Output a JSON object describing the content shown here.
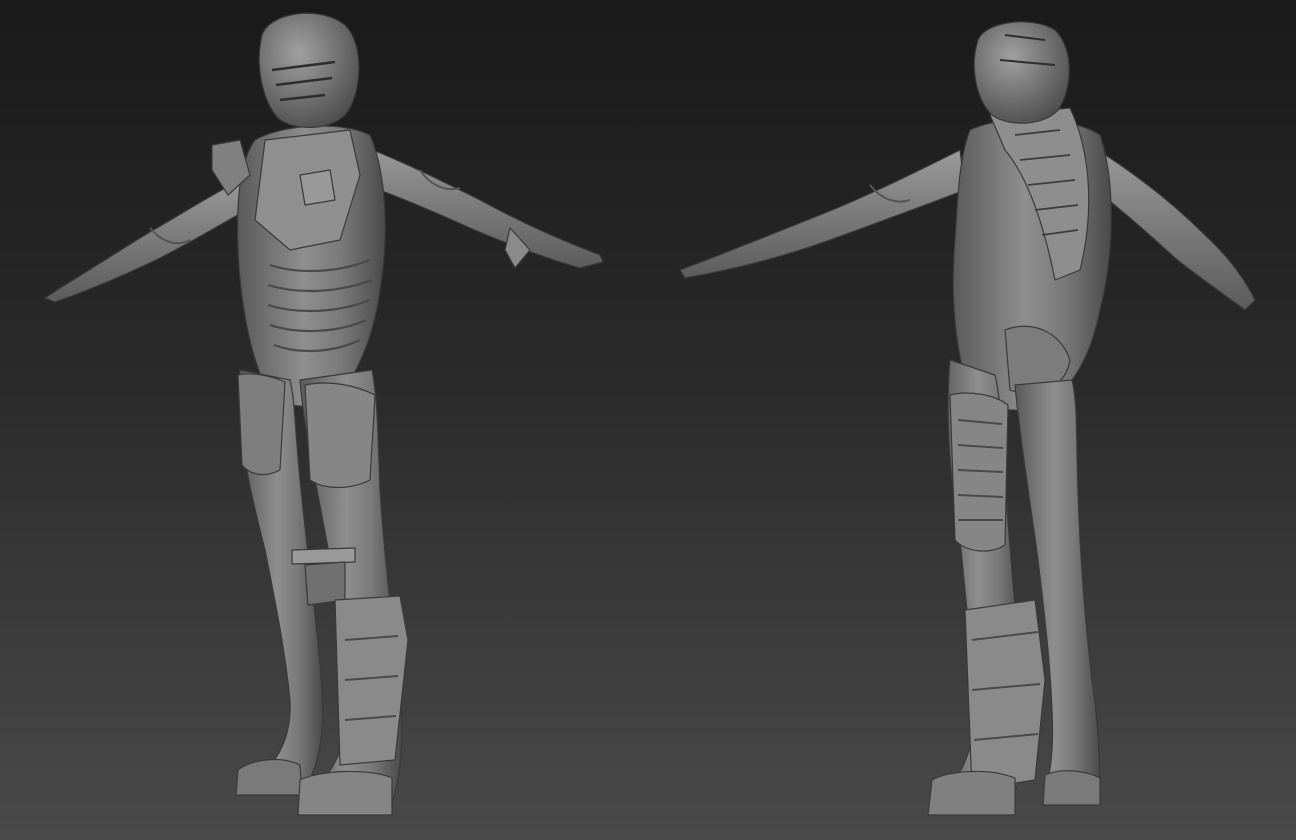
{
  "scene": {
    "background_top": "#1a1a1a",
    "background_bottom": "#4a4a4a",
    "material_color": "#7d7d7d",
    "highlight_color": "#a5a5a5",
    "shadow_color": "#3a3a3a",
    "figures": [
      {
        "view": "front-three-quarter",
        "pose": "T-pose"
      },
      {
        "view": "back-three-quarter",
        "pose": "T-pose"
      }
    ]
  }
}
